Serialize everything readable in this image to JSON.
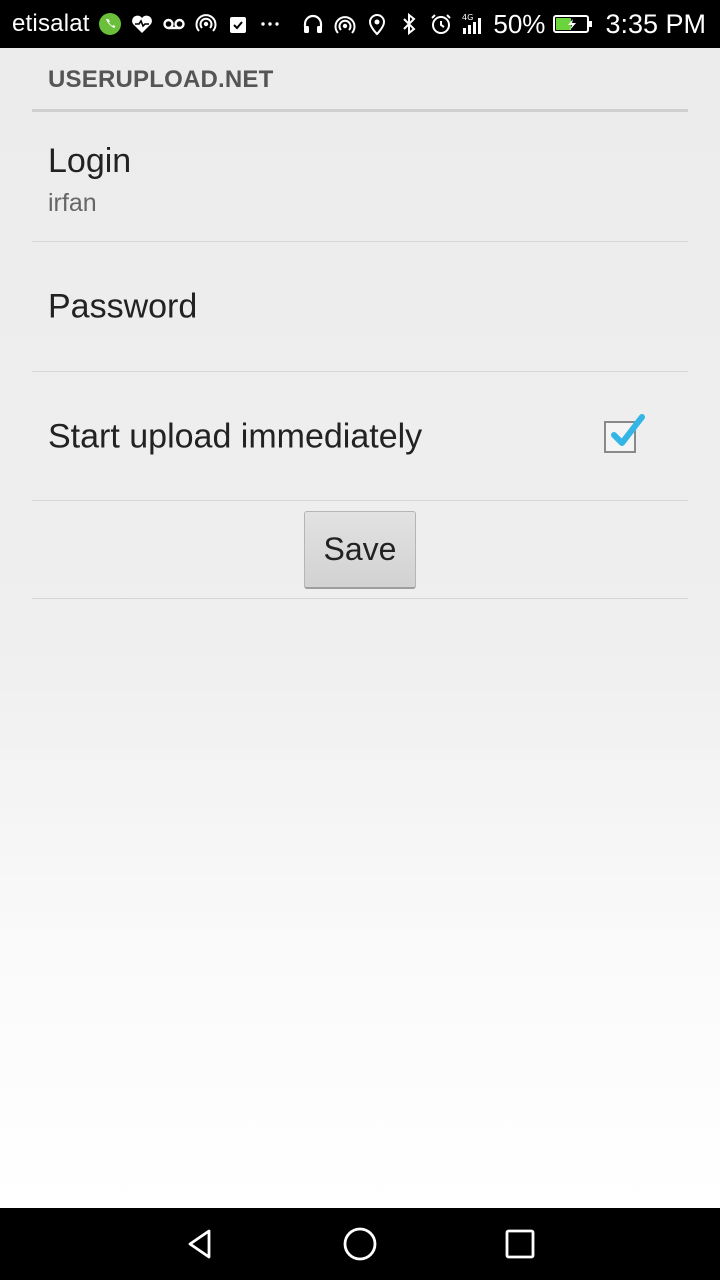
{
  "status_bar": {
    "carrier": "etisalat",
    "battery_percent": "50%",
    "time": "3:35 PM",
    "left_icons": [
      "phone-icon",
      "health-icon",
      "voicemail-icon",
      "hotspot-icon",
      "clipboard-icon",
      "more-dots-icon"
    ],
    "right_icons": [
      "headset-icon",
      "wireless-icon",
      "location-icon",
      "bluetooth-icon",
      "alarm-icon",
      "signal-4g-icon",
      "battery-icon"
    ]
  },
  "settings": {
    "category_title": "USERUPLOAD.NET",
    "login": {
      "title": "Login",
      "summary": "irfan"
    },
    "password": {
      "title": "Password"
    },
    "start_upload": {
      "title": "Start upload immediately",
      "checked": true
    },
    "save_label": "Save"
  },
  "colors": {
    "accent_check": "#33b5e5",
    "background_top": "#ececec",
    "phone_icon": "#6bbf3a",
    "battery_fill": "#6bd43a"
  },
  "nav_bar": {
    "buttons": [
      "back-icon",
      "home-icon",
      "recents-icon"
    ]
  }
}
